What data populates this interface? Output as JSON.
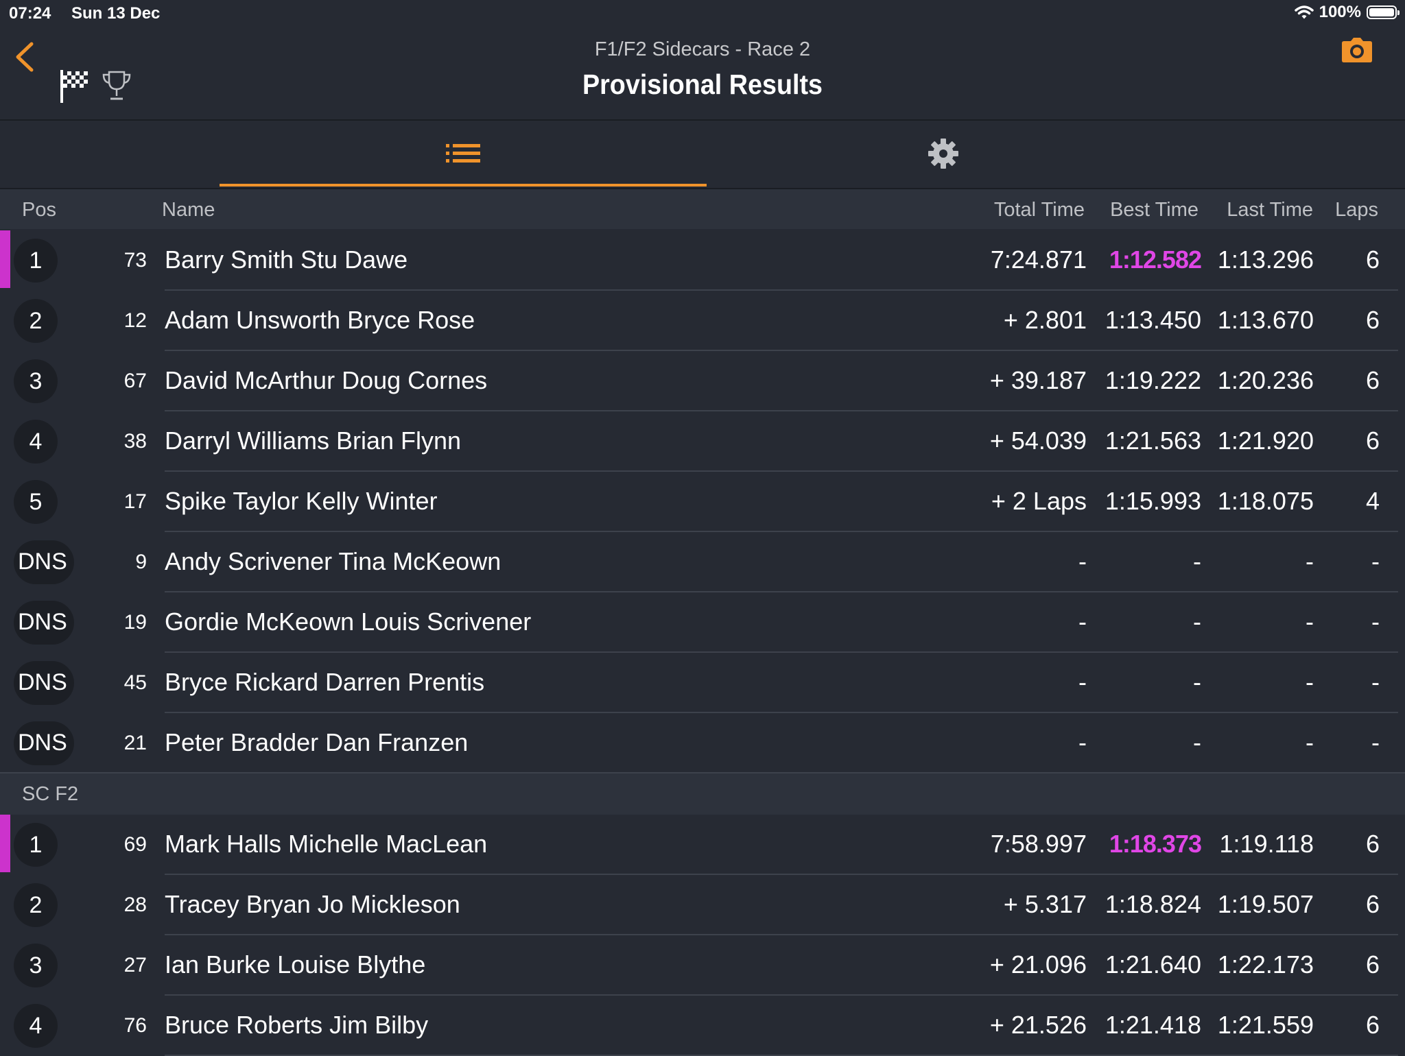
{
  "status": {
    "time": "07:24",
    "date": "Sun 13 Dec",
    "battery": "100%"
  },
  "header": {
    "subtitle": "F1/F2 Sidecars - Race 2",
    "title": "Provisional Results"
  },
  "colors": {
    "accent": "#f0932b",
    "fastest": "#e046e6",
    "background": "#262a33"
  },
  "columns": {
    "pos": "Pos",
    "name": "Name",
    "total": "Total Time",
    "best": "Best Time",
    "last": "Last Time",
    "laps": "Laps"
  },
  "groups": [
    {
      "label": "",
      "rows": [
        {
          "pos": "1",
          "num": "73",
          "name": "Barry Smith Stu Dawe",
          "total": "7:24.871",
          "best": "1:12.582",
          "last": "1:13.296",
          "laps": "6",
          "fastest": true
        },
        {
          "pos": "2",
          "num": "12",
          "name": "Adam Unsworth Bryce Rose",
          "total": "+ 2.801",
          "best": "1:13.450",
          "last": "1:13.670",
          "laps": "6",
          "fastest": false
        },
        {
          "pos": "3",
          "num": "67",
          "name": "David McArthur Doug Cornes",
          "total": "+ 39.187",
          "best": "1:19.222",
          "last": "1:20.236",
          "laps": "6",
          "fastest": false
        },
        {
          "pos": "4",
          "num": "38",
          "name": "Darryl Williams Brian Flynn",
          "total": "+ 54.039",
          "best": "1:21.563",
          "last": "1:21.920",
          "laps": "6",
          "fastest": false
        },
        {
          "pos": "5",
          "num": "17",
          "name": "Spike Taylor Kelly Winter",
          "total": "+ 2 Laps",
          "best": "1:15.993",
          "last": "1:18.075",
          "laps": "4",
          "fastest": false
        },
        {
          "pos": "DNS",
          "num": "9",
          "name": "Andy Scrivener Tina McKeown",
          "total": "-",
          "best": "-",
          "last": "-",
          "laps": "-",
          "fastest": false
        },
        {
          "pos": "DNS",
          "num": "19",
          "name": "Gordie McKeown Louis Scrivener",
          "total": "-",
          "best": "-",
          "last": "-",
          "laps": "-",
          "fastest": false
        },
        {
          "pos": "DNS",
          "num": "45",
          "name": "Bryce Rickard Darren Prentis",
          "total": "-",
          "best": "-",
          "last": "-",
          "laps": "-",
          "fastest": false
        },
        {
          "pos": "DNS",
          "num": "21",
          "name": "Peter Bradder Dan Franzen",
          "total": "-",
          "best": "-",
          "last": "-",
          "laps": "-",
          "fastest": false
        }
      ]
    },
    {
      "label": "SC F2",
      "rows": [
        {
          "pos": "1",
          "num": "69",
          "name": "Mark Halls Michelle MacLean",
          "total": "7:58.997",
          "best": "1:18.373",
          "last": "1:19.118",
          "laps": "6",
          "fastest": true
        },
        {
          "pos": "2",
          "num": "28",
          "name": "Tracey Bryan Jo Mickleson",
          "total": "+ 5.317",
          "best": "1:18.824",
          "last": "1:19.507",
          "laps": "6",
          "fastest": false
        },
        {
          "pos": "3",
          "num": "27",
          "name": "Ian Burke Louise Blythe",
          "total": "+ 21.096",
          "best": "1:21.640",
          "last": "1:22.173",
          "laps": "6",
          "fastest": false
        },
        {
          "pos": "4",
          "num": "76",
          "name": "Bruce Roberts Jim Bilby",
          "total": "+ 21.526",
          "best": "1:21.418",
          "last": "1:21.559",
          "laps": "6",
          "fastest": false
        }
      ]
    }
  ]
}
